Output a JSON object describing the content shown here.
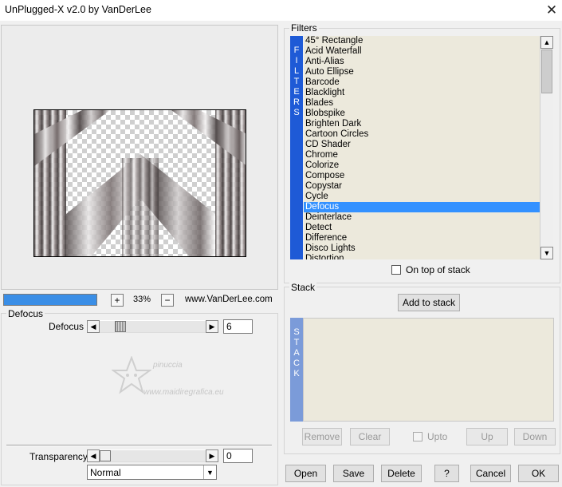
{
  "window": {
    "title": "UnPlugged-X v2.0 by VanDerLee",
    "close_glyph": "✕"
  },
  "preview": {
    "progress": 1.0,
    "zoom_plus": "+",
    "zoom_value": "33%",
    "zoom_minus": "−",
    "website": "www.VanDerLee.com",
    "accent_color": "#3a8ee6"
  },
  "filters": {
    "group_label": "Filters",
    "strip_letters": [
      "F",
      "I",
      "L",
      "T",
      "E",
      "R",
      "S"
    ],
    "strip_color": "#1e5ad6",
    "items": [
      "45° Rectangle",
      "Acid Waterfall",
      "Anti-Alias",
      "Auto Ellipse",
      "Barcode",
      "Blacklight",
      "Blades",
      "Blobspike",
      "Brighten Dark",
      "Cartoon Circles",
      "CD Shader",
      "Chrome",
      "Colorize",
      "Compose",
      "Copystar",
      "Cycle",
      "Defocus",
      "Deinterlace",
      "Detect",
      "Difference",
      "Disco Lights",
      "Distortion"
    ],
    "selected": "Defocus",
    "on_top_label": "On top of stack",
    "on_top_checked": false
  },
  "params": {
    "group_label": "Defocus",
    "defocus_label": "Defocus",
    "defocus_value": "6",
    "defocus_level": 0.04,
    "transparency_label": "Transparency",
    "transparency_value": "0",
    "transparency_level": 0.0,
    "blend_mode": "Normal"
  },
  "stack": {
    "group_label": "Stack",
    "add_button": "Add to stack",
    "strip_letters": [
      "S",
      "T",
      "A",
      "C",
      "K"
    ],
    "strip_color": "#7b9bd9",
    "remove_button": "Remove",
    "clear_button": "Clear",
    "upto_label": "Upto",
    "up_button": "Up",
    "down_button": "Down"
  },
  "footer": {
    "open": "Open",
    "save": "Save",
    "delete": "Delete",
    "help": "?",
    "cancel": "Cancel",
    "ok": "OK"
  },
  "watermark": {
    "line1": "pinuccia",
    "line2": "www.maidiregrafica.eu"
  },
  "icons": {
    "left_arrow": "◀",
    "right_arrow": "▶",
    "up_arrow": "▲",
    "down_arrow": "▼",
    "dropdown": "▼"
  }
}
